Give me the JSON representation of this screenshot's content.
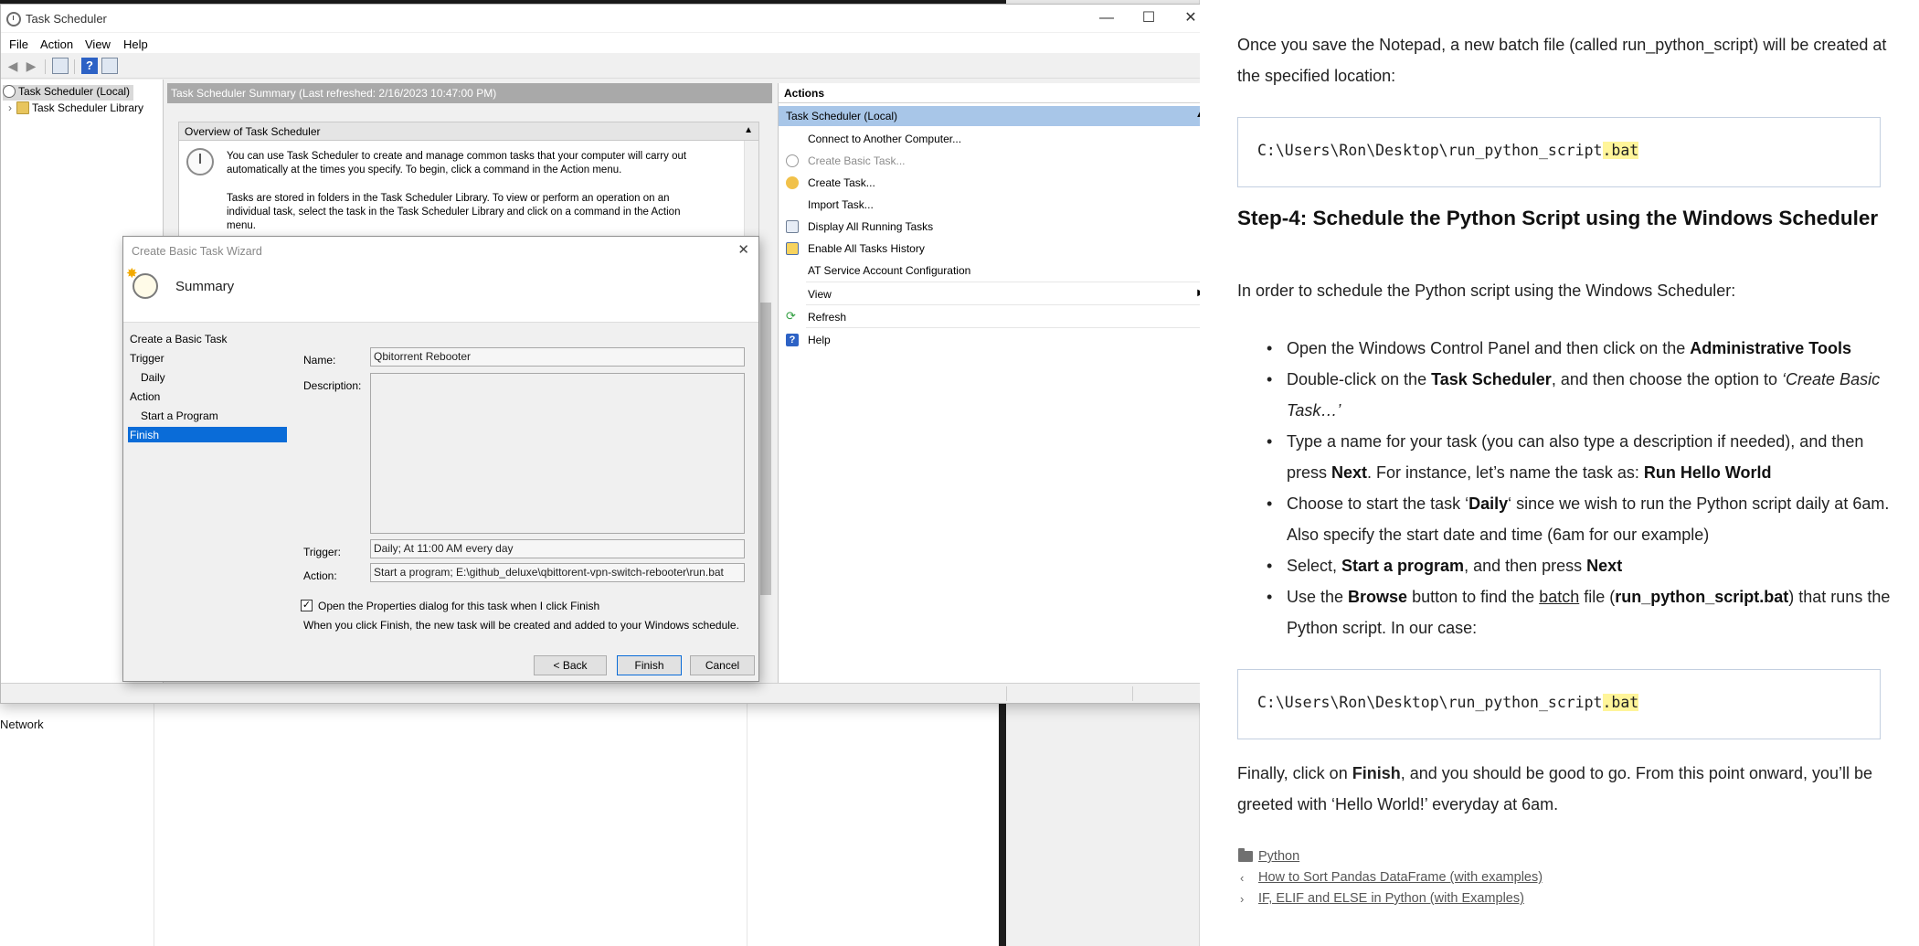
{
  "task_scheduler": {
    "window_title": "Task Scheduler",
    "window_controls": {
      "minimize": "—",
      "maximize": "☐",
      "close": "✕"
    },
    "menu": [
      "File",
      "Action",
      "View",
      "Help"
    ],
    "tree": {
      "root": "Task Scheduler (Local)",
      "library": "Task Scheduler Library",
      "expand_glyph": "›"
    },
    "summary_header": "Task Scheduler Summary (Last refreshed: 2/16/2023 10:47:00 PM)",
    "overview": {
      "title": "Overview of Task Scheduler",
      "text1": "You can use Task Scheduler to create and manage common tasks that your computer will carry out automatically at the times you specify. To begin, click a command in the Action menu.",
      "text2": "Tasks are stored in folders in the Task Scheduler Library. To view or perform an operation on an individual task, select the task in the Task Scheduler Library and click on a command in the Action menu."
    },
    "actions": {
      "title": "Actions",
      "group": "Task Scheduler (Local)",
      "items": [
        "Connect to Another Computer...",
        "Create Basic Task...",
        "Create Task...",
        "Import Task...",
        "Display All Running Tasks",
        "Enable All Tasks History",
        "AT Service Account Configuration",
        "View",
        "Refresh",
        "Help"
      ]
    }
  },
  "wizard": {
    "title": "Create Basic Task Wizard",
    "header": "Summary",
    "steps": [
      "Create a Basic Task",
      "Trigger",
      "Daily",
      "Action",
      "Start a Program",
      "Finish"
    ],
    "name_label": "Name:",
    "name_value": "Qbitorrent Rebooter",
    "description_label": "Description:",
    "description_value": "",
    "trigger_label": "Trigger:",
    "trigger_value": "Daily; At 11:00 AM every day",
    "action_label": "Action:",
    "action_value": "Start a program; E:\\github_deluxe\\qbittorent-vpn-switch-rebooter\\run.bat",
    "checkbox_label": "Open the Properties dialog for this task when I click Finish",
    "checkbox_checked": true,
    "note": "When you click Finish, the new task will be created and added to your Windows schedule.",
    "buttons": {
      "back": "< Back",
      "finish": "Finish",
      "cancel": "Cancel"
    }
  },
  "background": {
    "network_label": "Network"
  },
  "article": {
    "intro": "Once you save the Notepad, a new batch file (called run_python_script) will be created at the specified location:",
    "code1_prefix": "C:\\Users\\Ron\\Desktop\\run_python_script",
    "code1_ext": ".bat",
    "heading": "Step-4: Schedule the Python Script using the Windows Scheduler",
    "lead": "In order to schedule the Python script using the Windows Scheduler:",
    "bullets": [
      {
        "t1": "Open the Windows Control Panel and then click on the ",
        "b1": "Administrative Tools"
      },
      {
        "t1": "Double-click on the ",
        "b1": "Task Scheduler",
        "t2": ", and then choose the option to ",
        "i1": "‘Create Basic Task…’"
      },
      {
        "t1": "Type a name for your task (you can also type a description if needed), and then press ",
        "b1": "Next",
        "t2": ". For instance, let’s name the task as: ",
        "b2": "Run Hello World"
      },
      {
        "t1": "Choose to start the task ‘",
        "b1": "Daily",
        "t2": "‘ since we wish to run the Python script daily at 6am. Also specify the start date and time (6am for our example)"
      },
      {
        "t1": "Select, ",
        "b1": "Start a program",
        "t2": ", and then press ",
        "b2": "Next"
      },
      {
        "t1": "Use the ",
        "b1": "Browse",
        "t2": " button to find the ",
        "u1": "batch",
        "t3": " file (",
        "b2": "run_python_script.bat",
        "t4": ") that runs the Python script. In our case:"
      }
    ],
    "code2_prefix": "C:\\Users\\Ron\\Desktop\\run_python_script",
    "code2_ext": ".bat",
    "final_t1": "Finally, click on ",
    "final_b1": "Finish",
    "final_t2": ", and you should be good to go. From this point onward, you’ll be greeted with ‘Hello World!’ everyday at 6am.",
    "category": "Python",
    "prev_link": "How to Sort Pandas DataFrame (with examples)",
    "next_link": "IF, ELIF and ELSE in Python (with Examples)"
  }
}
